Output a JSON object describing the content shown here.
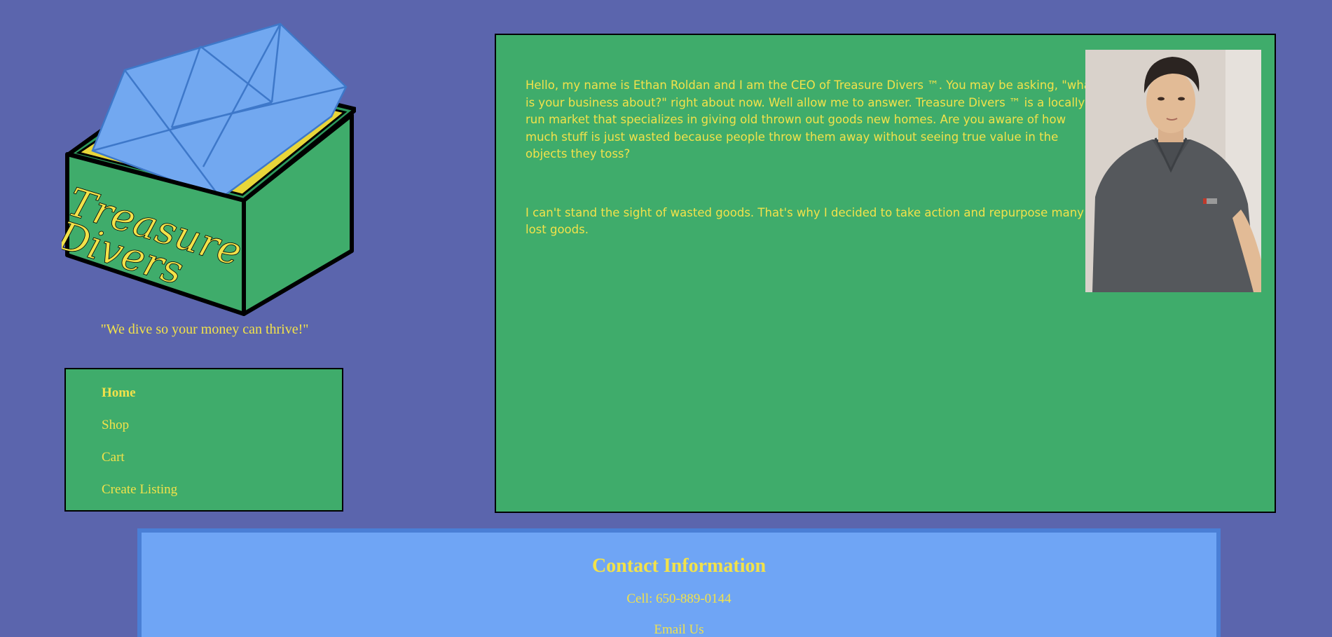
{
  "brand": {
    "logo_text_line1": "Treasure",
    "logo_text_line2": "Divers",
    "tagline": "\"We dive so your money can thrive!\""
  },
  "nav": {
    "items": [
      {
        "label": "Home",
        "active": true
      },
      {
        "label": "Shop",
        "active": false
      },
      {
        "label": "Cart",
        "active": false
      },
      {
        "label": "Create Listing",
        "active": false
      }
    ]
  },
  "main": {
    "paragraphs": [
      "Hello, my name is Ethan Roldan and I am the CEO of Treasure Divers ™. You may be asking, \"what is your business about?\" right about now. Well allow me to answer. Treasure Divers ™ is a locally run market that specializes in giving old thrown out goods new homes. Are you aware of how much stuff is just wasted because people throw them away without seeing true value in the objects they toss?",
      "I can't stand the sight of wasted goods. That's why I decided to take action and repurpose many lost goods."
    ]
  },
  "footer": {
    "title": "Contact Information",
    "cell": "Cell: 650-889-0144",
    "email": "Email Us"
  },
  "colors": {
    "background": "#5b65ad",
    "panel_green": "#3fac6b",
    "text_yellow": "#f2e24a",
    "footer_blue": "#6fa5f5"
  }
}
